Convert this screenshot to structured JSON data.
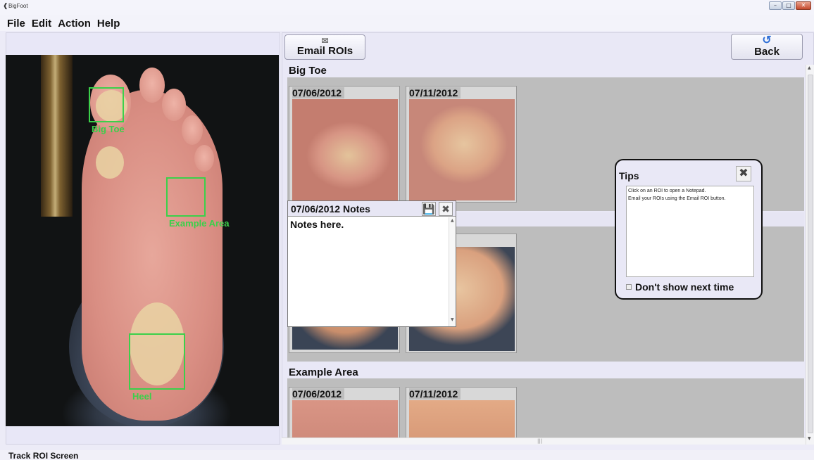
{
  "window": {
    "title": "BigFoot",
    "minimize": "–",
    "maximize": "□",
    "close": "✕"
  },
  "menu": [
    "File",
    "Edit",
    "Action",
    "Help"
  ],
  "toolbar": {
    "email_label": "Email ROIs",
    "email_icon": "envelope-icon",
    "back_label": "Back",
    "back_icon": "back-arrow-icon"
  },
  "foot_image": {
    "roi_labels": {
      "big_toe": "Big Toe",
      "example_area": "Example Area",
      "heel": "Heel"
    },
    "roi_color": "#3bd04a"
  },
  "sections": [
    {
      "title": "Big Toe",
      "dates": [
        "07/06/2012",
        "07/11/2012"
      ]
    },
    {
      "title": "",
      "dates": [
        "",
        "2"
      ]
    },
    {
      "title": "Example Area",
      "dates": [
        "07/06/2012",
        "07/11/2012"
      ]
    }
  ],
  "notes": {
    "title": "07/06/2012 Notes",
    "text": "Notes here.",
    "save_icon": "save-icon",
    "close_icon": "close-icon"
  },
  "tips": {
    "title": "Tips",
    "lines": [
      "Click on an ROI to open a Notepad.",
      "Email your ROIs using the Email ROI button."
    ],
    "checkbox_label": "Don't show next time",
    "checked": false
  },
  "status": "Track ROI Screen"
}
